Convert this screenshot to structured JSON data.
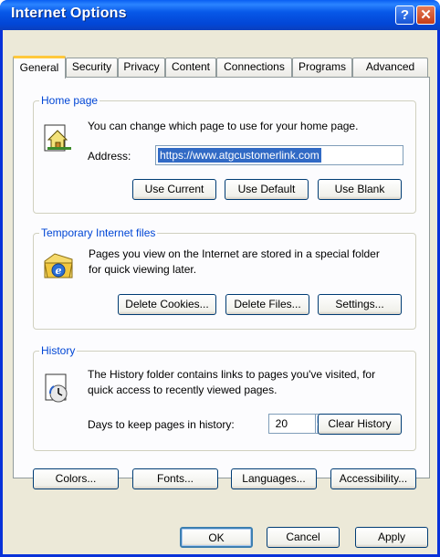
{
  "window": {
    "title": "Internet Options"
  },
  "tabs": [
    "General",
    "Security",
    "Privacy",
    "Content",
    "Connections",
    "Programs",
    "Advanced"
  ],
  "home_page": {
    "legend": "Home page",
    "description": "You can change which page to use for your home page.",
    "address_label": "Address:",
    "address_value": "https://www.atgcustomerlink.com",
    "buttons": {
      "use_current": "Use Current",
      "use_default": "Use Default",
      "use_blank": "Use Blank"
    }
  },
  "temp_files": {
    "legend": "Temporary Internet files",
    "description_line1": "Pages you view on the Internet are stored in a special folder",
    "description_line2": "for quick viewing later.",
    "buttons": {
      "delete_cookies": "Delete Cookies...",
      "delete_files": "Delete Files...",
      "settings": "Settings..."
    }
  },
  "history": {
    "legend": "History",
    "description_line1": "The History folder contains links to pages you've visited, for",
    "description_line2": "quick access to recently viewed pages.",
    "days_label": "Days to keep pages in history:",
    "days_value": "20",
    "clear_button": "Clear History"
  },
  "bottom_buttons": {
    "colors": "Colors...",
    "fonts": "Fonts...",
    "languages": "Languages...",
    "accessibility": "Accessibility..."
  },
  "dialog_buttons": {
    "ok": "OK",
    "cancel": "Cancel",
    "apply": "Apply"
  },
  "icons": {
    "help": "?",
    "close": "✕"
  }
}
